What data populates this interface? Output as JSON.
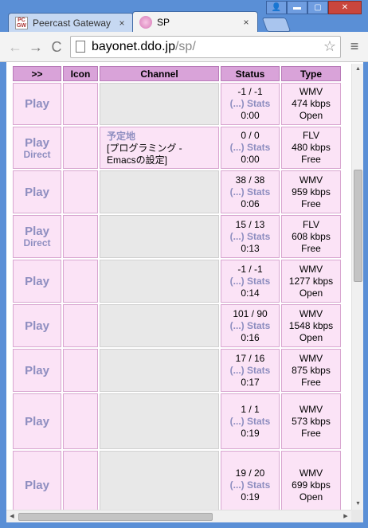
{
  "browser": {
    "tabs": [
      {
        "title": "Peercast Gateway",
        "icon": "peercast-icon",
        "active": false
      },
      {
        "title": "SP",
        "icon": "sp-icon",
        "active": true
      }
    ],
    "url_host": "bayonet.ddo.jp",
    "url_path": "/sp/",
    "window_controls": {
      "user": "👤",
      "minimize": "▬",
      "maximize": "▢",
      "close": "✕"
    },
    "nav": {
      "back": "←",
      "forward": "→",
      "reload": "C"
    },
    "star": "☆",
    "menu": "≡",
    "tab_close": "×"
  },
  "table": {
    "headers": [
      ">>",
      "Icon",
      "Channel",
      "Status",
      "Type"
    ],
    "rows": [
      {
        "play": "Play",
        "direct": "",
        "channel_name": "",
        "channel_desc": "",
        "listeners": "-1 / -1",
        "more": "(...)",
        "stats": "Stats",
        "time": "0:00",
        "format": "WMV",
        "bitrate": "474 kbps",
        "access": "Open"
      },
      {
        "play": "Play",
        "direct": "Direct",
        "channel_name": "予定地",
        "channel_desc": "[プログラミング - Emacsの設定]",
        "listeners": "0 / 0",
        "more": "(...)",
        "stats": "Stats",
        "time": "0:00",
        "format": "FLV",
        "bitrate": "480 kbps",
        "access": "Free"
      },
      {
        "play": "Play",
        "direct": "",
        "channel_name": "",
        "channel_desc": "",
        "listeners": "38 / 38",
        "more": "(...)",
        "stats": "Stats",
        "time": "0:06",
        "format": "WMV",
        "bitrate": "959 kbps",
        "access": "Free"
      },
      {
        "play": "Play",
        "direct": "Direct",
        "channel_name": "",
        "channel_desc": "",
        "listeners": "15 / 13",
        "more": "(...)",
        "stats": "Stats",
        "time": "0:13",
        "format": "FLV",
        "bitrate": "608 kbps",
        "access": "Free"
      },
      {
        "play": "Play",
        "direct": "",
        "channel_name": "",
        "channel_desc": "",
        "listeners": "-1 / -1",
        "more": "(...)",
        "stats": "Stats",
        "time": "0:14",
        "format": "WMV",
        "bitrate": "1277 kbps",
        "access": "Open"
      },
      {
        "play": "Play",
        "direct": "",
        "channel_name": "",
        "channel_desc": "",
        "listeners": "101 / 90",
        "more": "(...)",
        "stats": "Stats",
        "time": "0:16",
        "format": "WMV",
        "bitrate": "1548 kbps",
        "access": "Open"
      },
      {
        "play": "Play",
        "direct": "",
        "channel_name": "",
        "channel_desc": "",
        "listeners": "17 / 16",
        "more": "(...)",
        "stats": "Stats",
        "time": "0:17",
        "format": "WMV",
        "bitrate": "875 kbps",
        "access": "Free"
      },
      {
        "play": "Play",
        "direct": "",
        "channel_name": "",
        "channel_desc": "",
        "listeners": "1 / 1",
        "more": "(...)",
        "stats": "Stats",
        "time": "0:19",
        "format": "WMV",
        "bitrate": "573 kbps",
        "access": "Free"
      },
      {
        "play": "Play",
        "direct": "",
        "channel_name": "",
        "channel_desc": "",
        "listeners": "19 / 20",
        "more": "(...)",
        "stats": "Stats",
        "time": "0:19",
        "format": "WMV",
        "bitrate": "699 kbps",
        "access": "Open"
      }
    ]
  },
  "colors": {
    "header_bg": "#d9a3d9",
    "cell_bg": "#fbe3f6",
    "link": "#8e8ec0",
    "frame": "#5a8fd6"
  }
}
